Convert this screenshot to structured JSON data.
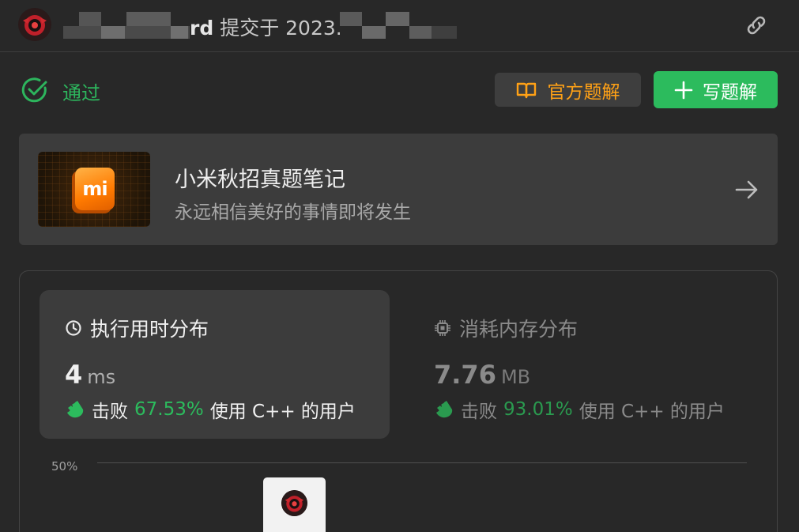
{
  "header": {
    "username_tail": "rd",
    "submitted_text": "提交于 2023."
  },
  "status": {
    "label": "通过",
    "color": "#2db55d"
  },
  "actions": {
    "official_solution_label": "官方题解",
    "write_solution_label": "写题解"
  },
  "banner": {
    "title": "小米秋招真题笔记",
    "subtitle": "永远相信美好的事情即将发生",
    "logo_text": "mi"
  },
  "stats": {
    "runtime": {
      "title": "执行用时分布",
      "value": "4",
      "unit": "ms",
      "beat_prefix": "击败",
      "percent": "67.53%",
      "beat_suffix": "使用 C++ 的用户"
    },
    "memory": {
      "title": "消耗内存分布",
      "value": "7.76",
      "unit": "MB",
      "beat_prefix": "击败",
      "percent": "93.01%",
      "beat_suffix": "使用 C++ 的用户"
    }
  },
  "chart": {
    "y_tick_label": "50%"
  },
  "colors": {
    "accent_green": "#2cbb5d",
    "accent_orange": "#ffa116",
    "background": "#282828"
  }
}
